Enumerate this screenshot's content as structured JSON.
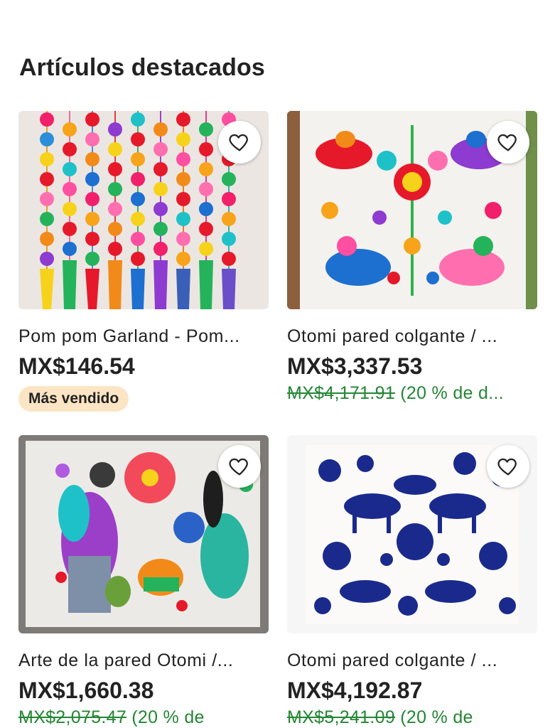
{
  "section": {
    "title": "Artículos destacados"
  },
  "items": [
    {
      "name": "Pom pom Garland - Pom...",
      "price": "MX$146.54",
      "badge": "Más vendido",
      "image_icon": "pom-pom-garland-photo"
    },
    {
      "name": "Otomi pared colgante / ...",
      "price": "MX$3,337.53",
      "original_price": "MX$4,171.91",
      "discount": "(20 % de d...",
      "image_icon": "otomi-multicolor-photo"
    },
    {
      "name": "Arte de la pared Otomi /...",
      "price": "MX$1,660.38",
      "original_price": "MX$2,075.47",
      "discount": "(20 % de",
      "image_icon": "otomi-women-photo"
    },
    {
      "name": "Otomi pared colgante / ...",
      "price": "MX$4,192.87",
      "original_price": "MX$5,241.09",
      "discount": "(20 % de",
      "image_icon": "otomi-blue-photo"
    }
  ],
  "favorite_icon": "heart-icon",
  "colors": {
    "text": "#222222",
    "discount_green": "#258635",
    "badge_bg": "#fce5c4",
    "blue_embroidery": "#1a2a8c"
  }
}
